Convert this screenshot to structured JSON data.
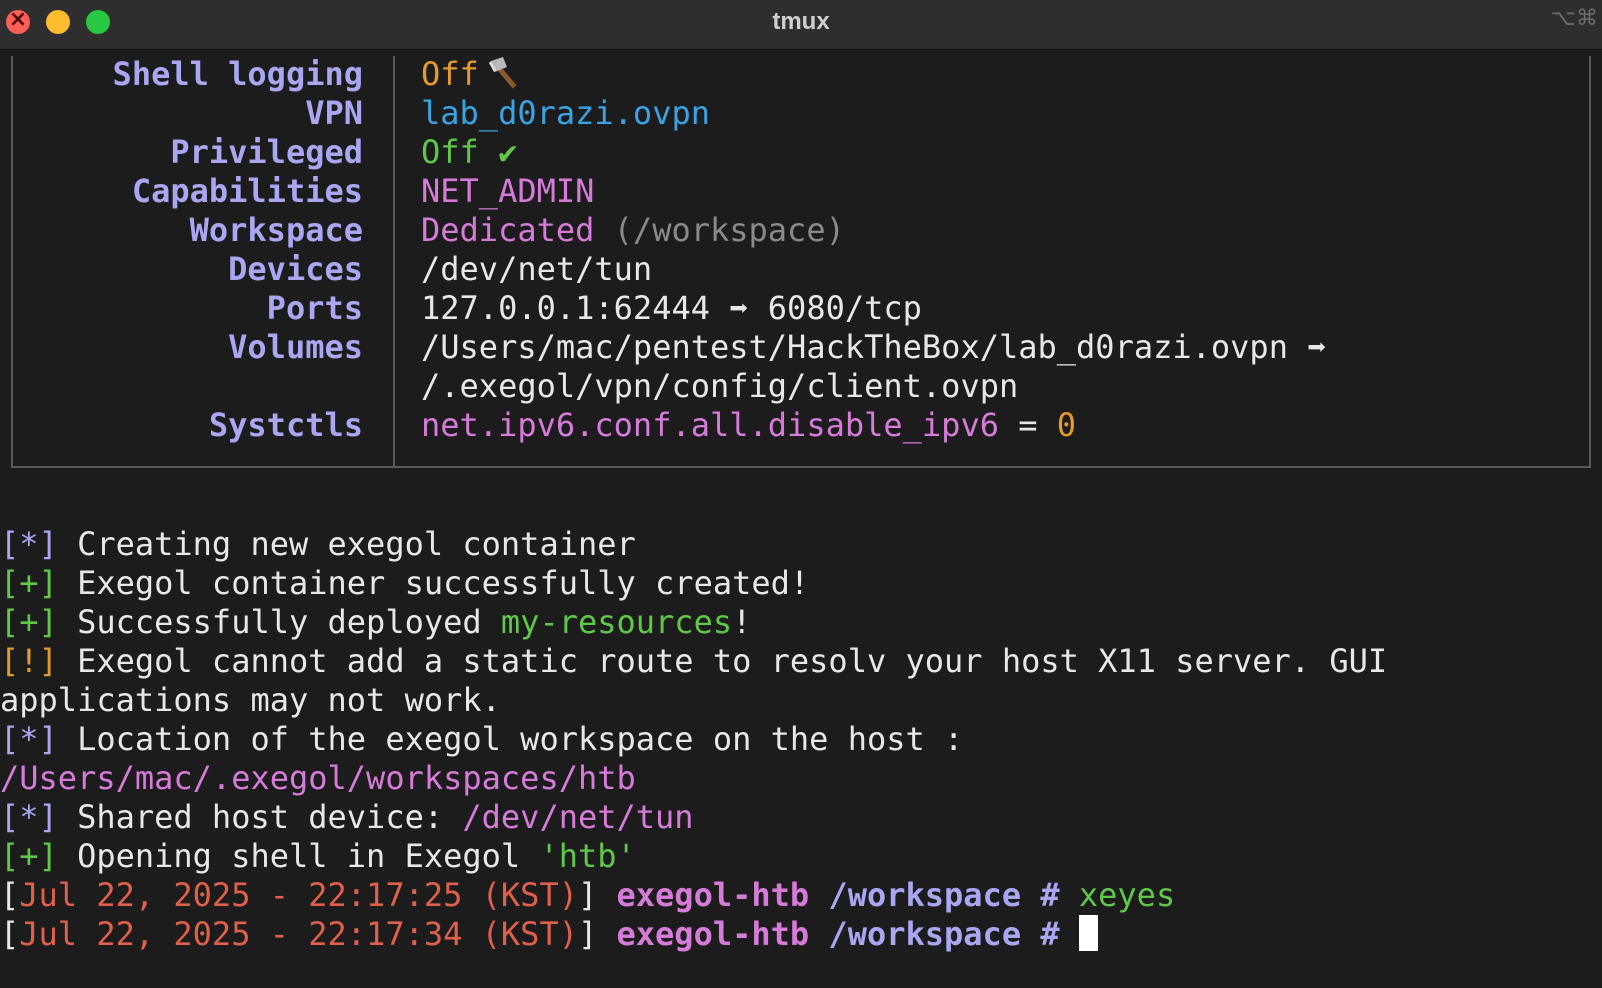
{
  "window": {
    "title": "tmux",
    "shortcut_glyph": "⌥⌘"
  },
  "info": {
    "rows": [
      {
        "key": "Shell logging",
        "value": "Off",
        "extra_icon": "hatchet-icon"
      },
      {
        "key": "VPN",
        "value": "lab_d0razi.ovpn"
      },
      {
        "key": "Privileged",
        "value": "Off",
        "check": "✔"
      },
      {
        "key": "Capabilities",
        "value": "NET_ADMIN"
      },
      {
        "key": "Workspace",
        "value": "Dedicated",
        "detail": "(/workspace)"
      },
      {
        "key": "Devices",
        "value": "/dev/net/tun"
      },
      {
        "key": "Ports",
        "value": "127.0.0.1:62444 ➡ 6080/tcp"
      },
      {
        "key": "Volumes",
        "value": "/Users/mac/pentest/HackTheBox/lab_d0razi.ovpn ➡",
        "value2": "/.exegol/vpn/config/client.ovpn"
      },
      {
        "key": "Systctls",
        "value": "net.ipv6.conf.all.disable_ipv6",
        "eq": " = ",
        "num": "0"
      }
    ]
  },
  "log": [
    {
      "prefix": "[*]",
      "text": " Creating new exegol container"
    },
    {
      "prefix": "[+]",
      "text": " Exegol container successfully created!"
    },
    {
      "prefix": "[+]",
      "text": " Successfully deployed ",
      "highlight": "my-resources",
      "suffix": "!"
    },
    {
      "prefix": "[!]",
      "text": " Exegol cannot add a static route to resolv your host X11 server. GUI",
      "cont": "applications may not work."
    },
    {
      "prefix": "[*]",
      "text": " Location of the exegol workspace on the host :",
      "cont": "/Users/mac/.exegol/workspaces/htb"
    },
    {
      "prefix": "[*]",
      "text": " Shared host device: ",
      "highlight": "/dev/net/tun"
    },
    {
      "prefix": "[+]",
      "text": " Opening shell in Exegol ",
      "highlight": "'htb'"
    }
  ],
  "prompts": [
    {
      "open": "[",
      "timestamp": "Jul 22, 2025 - 22:17:25 (KST)",
      "close": "]",
      "host": " exegol-htb",
      "path": " /workspace #",
      "command": " xeyes"
    },
    {
      "open": "[",
      "timestamp": "Jul 22, 2025 - 22:17:34 (KST)",
      "close": "]",
      "host": " exegol-htb",
      "path": " /workspace #",
      "command": " "
    }
  ],
  "colors": {
    "background": "#1c1c1c",
    "key": "#a9a6f2",
    "orange": "#e49b2c",
    "blue": "#3aa3e3",
    "green": "#5fc849",
    "pink": "#d77bda",
    "red": "#e0604a"
  }
}
